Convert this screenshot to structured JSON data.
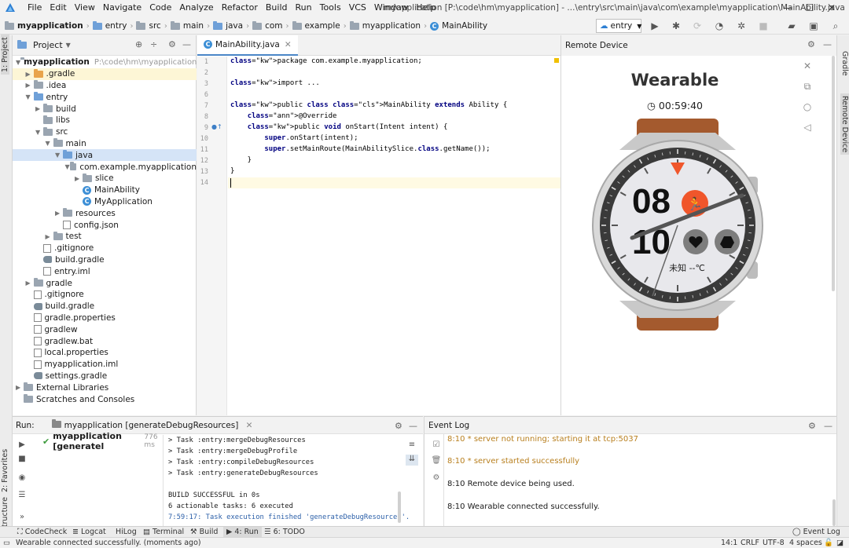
{
  "menubar": {
    "items": [
      "File",
      "Edit",
      "View",
      "Navigate",
      "Code",
      "Analyze",
      "Refactor",
      "Build",
      "Run",
      "Tools",
      "VCS",
      "Window",
      "Help"
    ],
    "title": "myapplication [P:\\code\\hm\\myapplication] - ...\\entry\\src\\main\\java\\com\\example\\myapplication\\MainAbility.java",
    "minimize": "—",
    "maximize": "☐",
    "close": "✕"
  },
  "breadcrumb": [
    "myapplication",
    "entry",
    "src",
    "main",
    "java",
    "com",
    "example",
    "myapplication",
    "MainAbility"
  ],
  "run_config": "entry",
  "project": {
    "title": "Project",
    "tree": [
      {
        "indent": 0,
        "label": "myapplication",
        "extra": "P:\\code\\hm\\myapplication",
        "arrow": "▼",
        "icon": "folder-gray",
        "bold": true
      },
      {
        "indent": 1,
        "label": ".gradle",
        "arrow": "▶",
        "icon": "folder-orange",
        "hl": true
      },
      {
        "indent": 1,
        "label": ".idea",
        "arrow": "▶",
        "icon": "folder-gray"
      },
      {
        "indent": 1,
        "label": "entry",
        "arrow": "▼",
        "icon": "folder-blue"
      },
      {
        "indent": 2,
        "label": "build",
        "arrow": "▶",
        "icon": "folder-gray"
      },
      {
        "indent": 2,
        "label": "libs",
        "arrow": "",
        "icon": "folder-gray"
      },
      {
        "indent": 2,
        "label": "src",
        "arrow": "▼",
        "icon": "folder-gray"
      },
      {
        "indent": 3,
        "label": "main",
        "arrow": "▼",
        "icon": "folder-gray"
      },
      {
        "indent": 4,
        "label": "java",
        "arrow": "▼",
        "icon": "folder-blue",
        "sel": true
      },
      {
        "indent": 5,
        "label": "com.example.myapplication",
        "arrow": "▼",
        "icon": "folder-gray"
      },
      {
        "indent": 6,
        "label": "slice",
        "arrow": "▶",
        "icon": "folder-gray"
      },
      {
        "indent": 6,
        "label": "MainAbility",
        "arrow": "",
        "icon": "class"
      },
      {
        "indent": 6,
        "label": "MyApplication",
        "arrow": "",
        "icon": "class"
      },
      {
        "indent": 4,
        "label": "resources",
        "arrow": "▶",
        "icon": "folder-gray"
      },
      {
        "indent": 4,
        "label": "config.json",
        "arrow": "",
        "icon": "file"
      },
      {
        "indent": 3,
        "label": "test",
        "arrow": "▶",
        "icon": "folder-gray"
      },
      {
        "indent": 2,
        "label": ".gitignore",
        "arrow": "",
        "icon": "file"
      },
      {
        "indent": 2,
        "label": "build.gradle",
        "arrow": "",
        "icon": "gradle"
      },
      {
        "indent": 2,
        "label": "entry.iml",
        "arrow": "",
        "icon": "file"
      },
      {
        "indent": 1,
        "label": "gradle",
        "arrow": "▶",
        "icon": "folder-gray"
      },
      {
        "indent": 1,
        "label": ".gitignore",
        "arrow": "",
        "icon": "file"
      },
      {
        "indent": 1,
        "label": "build.gradle",
        "arrow": "",
        "icon": "gradle"
      },
      {
        "indent": 1,
        "label": "gradle.properties",
        "arrow": "",
        "icon": "file"
      },
      {
        "indent": 1,
        "label": "gradlew",
        "arrow": "",
        "icon": "file"
      },
      {
        "indent": 1,
        "label": "gradlew.bat",
        "arrow": "",
        "icon": "file"
      },
      {
        "indent": 1,
        "label": "local.properties",
        "arrow": "",
        "icon": "file"
      },
      {
        "indent": 1,
        "label": "myapplication.iml",
        "arrow": "",
        "icon": "file"
      },
      {
        "indent": 1,
        "label": "settings.gradle",
        "arrow": "",
        "icon": "gradle"
      },
      {
        "indent": 0,
        "label": "External Libraries",
        "arrow": "▶",
        "icon": "folder-gray"
      },
      {
        "indent": 0,
        "label": "Scratches and Consoles",
        "arrow": "",
        "icon": "folder-gray"
      }
    ]
  },
  "editor": {
    "tab": "MainAbility.java",
    "line_numbers": [
      "1",
      "2",
      "3",
      "6",
      "7",
      "8",
      "9",
      "10",
      "11",
      "12",
      "13",
      "14"
    ],
    "code": [
      "package com.example.myapplication;",
      "",
      "import ...",
      "",
      "public class MainAbility extends Ability {",
      "    @Override",
      "    public void onStart(Intent intent) {",
      "        super.onStart(intent);",
      "        super.setMainRoute(MainAbilitySlice.class.getName());",
      "    }",
      "}",
      ""
    ]
  },
  "remote": {
    "title": "Remote Device",
    "device_title": "Wearable",
    "timer": "00:59:40",
    "watch_hour": "08",
    "watch_minute": "10",
    "watch_weather": "未知 --℃",
    "colors": {
      "strap": "#a45a2e",
      "accent": "#f0562b",
      "bezel": "#3a3a3a"
    }
  },
  "run": {
    "label": "Run:",
    "config_tab": "myapplication [generateDebugResources]",
    "tree_item": "myapplication [generatel",
    "tree_time": "776 ms",
    "console": [
      "> Task :entry:mergeDebugResources",
      "> Task :entry:mergeDebugProfile",
      "> Task :entry:compileDebugResources",
      "> Task :entry:generateDebugResources",
      "",
      "BUILD SUCCESSFUL in 0s",
      "6 actionable tasks: 6 executed",
      "7:59:17: Task execution finished 'generateDebugResources'."
    ]
  },
  "eventlog": {
    "title": "Event Log",
    "lines": [
      {
        "text": "8:10 * server not running; starting it at tcp:5037",
        "warn": true
      },
      {
        "text": "8:10 * server started successfully",
        "warn": true
      },
      {
        "text": "8:10 Remote device being used.",
        "warn": false
      },
      {
        "text": "8:10 Wearable connected successfully.",
        "warn": false
      }
    ]
  },
  "left_tabs": [
    "1: Project",
    "2: Favorites",
    "Z: Structure"
  ],
  "right_tabs": [
    "Gradle",
    "Remote Device"
  ],
  "tool_tabs": [
    "CodeCheck",
    "Logcat",
    "HiLog",
    "Terminal",
    "Build",
    "4: Run",
    "6: TODO"
  ],
  "event_log_tab": "Event Log",
  "status": {
    "message": "Wearable connected successfully. (moments ago)",
    "position": "14:1",
    "line_sep": "CRLF",
    "encoding": "UTF-8",
    "indent": "4 spaces"
  }
}
